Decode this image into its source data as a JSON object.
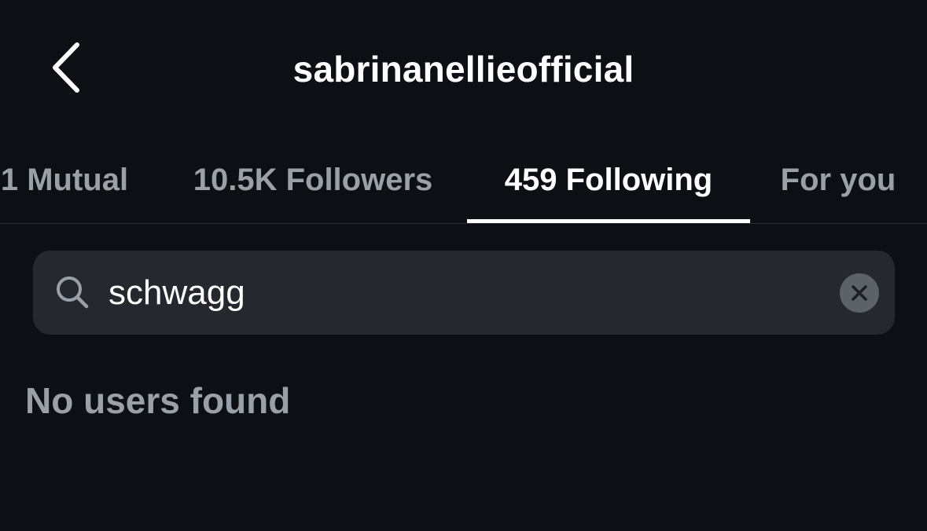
{
  "header": {
    "title": "sabrinanellieofficial",
    "back_icon": "chevron-left-icon"
  },
  "tabs": [
    {
      "label": "1 Mutual",
      "active": false
    },
    {
      "label": "10.5K Followers",
      "active": false
    },
    {
      "label": "459 Following",
      "active": true
    },
    {
      "label": "For you",
      "active": false
    }
  ],
  "search": {
    "value": "schwagg",
    "icon": "search-icon",
    "clear_icon": "close-icon"
  },
  "results": {
    "empty_message": "No users found"
  },
  "colors": {
    "background": "#0c0f14",
    "search_field": "#25282e",
    "inactive_text": "#9aa0a8",
    "active_text": "#ffffff",
    "divider": "#2a2e35"
  }
}
